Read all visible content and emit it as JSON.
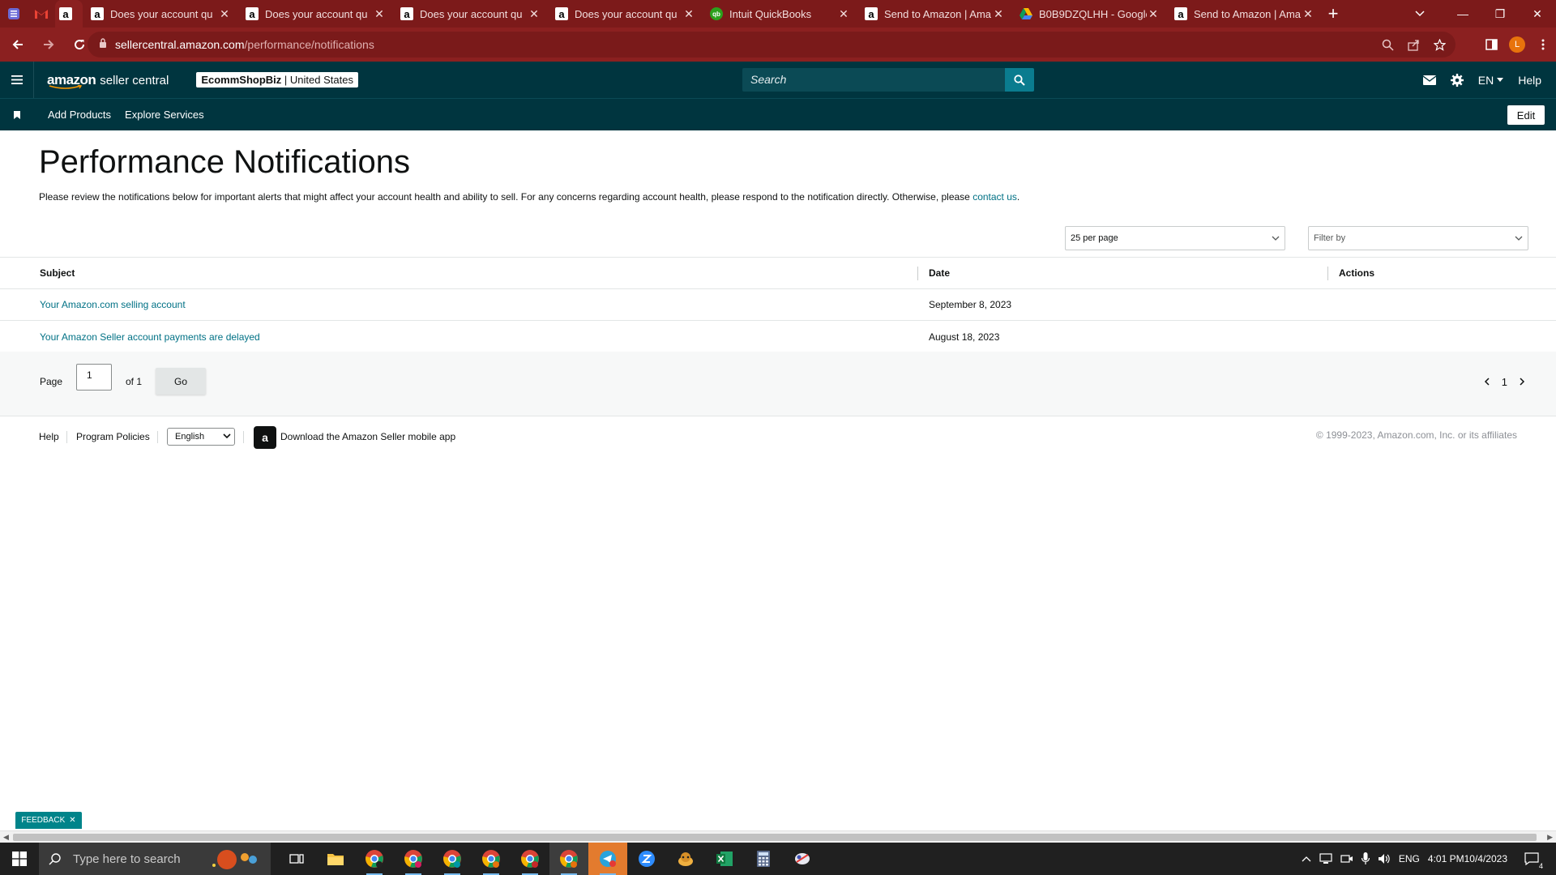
{
  "browser": {
    "tabs": [
      {
        "title": "Does your account qu",
        "favicon": "amazon-icon"
      },
      {
        "title": "Does your account qu",
        "favicon": "amazon-icon"
      },
      {
        "title": "Does your account qu",
        "favicon": "amazon-icon"
      },
      {
        "title": "Does your account qu",
        "favicon": "amazon-icon"
      },
      {
        "title": "Intuit QuickBooks",
        "favicon": "quickbooks-icon"
      },
      {
        "title": "Send to Amazon | Ama",
        "favicon": "amazon-icon"
      },
      {
        "title": "B0B9DZQLHH - Google",
        "favicon": "google-drive-icon"
      },
      {
        "title": "Send to Amazon | Ama",
        "favicon": "amazon-icon"
      }
    ],
    "url_host": "sellercentral.amazon.com",
    "url_path": "/performance/notifications",
    "profile_initial": "L",
    "theme_color": "#8b2020"
  },
  "header": {
    "logo_brand": "amazon",
    "logo_product": "seller central",
    "store_name": "EcommShopBiz",
    "store_region": " | United States",
    "search_placeholder": "Search",
    "language": "EN",
    "help": "Help",
    "bg_color": "#00353f"
  },
  "nav": {
    "items": [
      "Add Products",
      "Explore Services"
    ],
    "edit": "Edit"
  },
  "main": {
    "title": "Performance Notifications",
    "description": "Please review the notifications below for important alerts that might affect your account health and ability to sell. For any concerns regarding account health, please respond to the notification directly. Otherwise, please ",
    "contact_link": "contact us",
    "description_end": ".",
    "per_page": "25 per page",
    "filter_placeholder": "Filter by",
    "columns": {
      "subject": "Subject",
      "date": "Date",
      "actions": "Actions"
    },
    "rows": [
      {
        "subject": "Your Amazon.com selling account",
        "date": "September 8, 2023"
      },
      {
        "subject": "Your Amazon Seller account payments are delayed",
        "date": "August 18, 2023"
      }
    ],
    "link_color": "#007185"
  },
  "pager": {
    "page_label": "Page",
    "page_value": "1",
    "of_label": "of 1",
    "go": "Go",
    "current": "1"
  },
  "footer": {
    "help": "Help",
    "policies": "Program Policies",
    "language": "English",
    "app_text": "Download the Amazon Seller mobile app",
    "copyright": "© 1999-2023, Amazon.com, Inc. or its affiliates"
  },
  "feedback": "FEEDBACK",
  "taskbar": {
    "search_placeholder": "Type here to search",
    "lang": "ENG",
    "time": "4:01 PM",
    "date": "10/4/2023",
    "notifications": "4"
  }
}
